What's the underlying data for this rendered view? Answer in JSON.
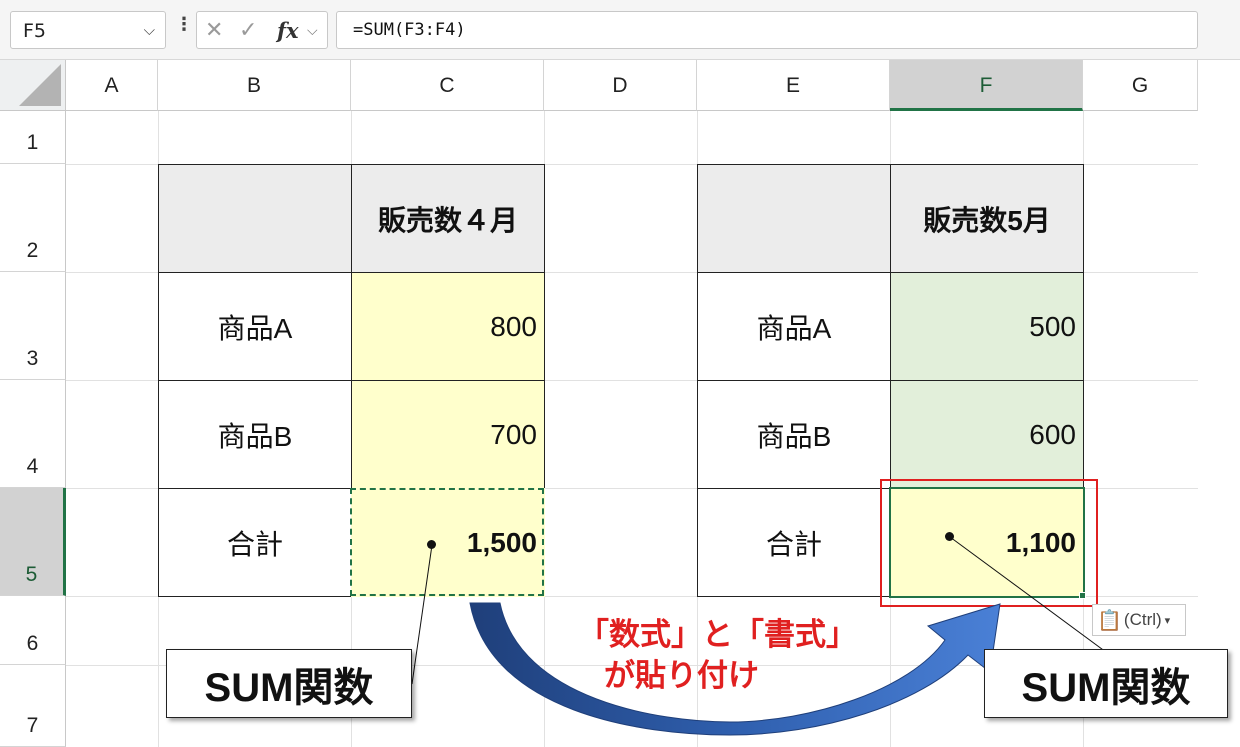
{
  "formula_bar": {
    "name_box": "F5",
    "cancel_icon": "✕",
    "enter_icon": "✓",
    "fx_label": "fx",
    "formula": "=SUM(F3:F4)"
  },
  "columns": [
    "A",
    "B",
    "C",
    "D",
    "E",
    "F",
    "G"
  ],
  "rows": [
    "1",
    "2",
    "3",
    "4",
    "5",
    "6",
    "7"
  ],
  "selected_column": "F",
  "selected_row": "5",
  "table_left": {
    "header": "販売数４月",
    "rows": [
      {
        "item": "商品A",
        "value": "800"
      },
      {
        "item": "商品B",
        "value": "700"
      }
    ],
    "total_label": "合計",
    "total_value": "1,500"
  },
  "table_right": {
    "header": "販売数5月",
    "rows": [
      {
        "item": "商品A",
        "value": "500"
      },
      {
        "item": "商品B",
        "value": "600"
      }
    ],
    "total_label": "合計",
    "total_value": "1,100"
  },
  "annotations": {
    "left_label": "SUM関数",
    "right_label": "SUM関数",
    "caption_line1": "「数式」と「書式」",
    "caption_line2": "が貼り付け"
  },
  "paste_options": {
    "icon": "clipboard-icon",
    "label": "(Ctrl)",
    "chevron": "▾"
  },
  "colors": {
    "accent_green": "#217346",
    "highlight_yellow": "#ffffcc",
    "highlight_green": "#e2efda",
    "annotation_red": "#e02020",
    "arrow_blue": "#2f5fae"
  }
}
